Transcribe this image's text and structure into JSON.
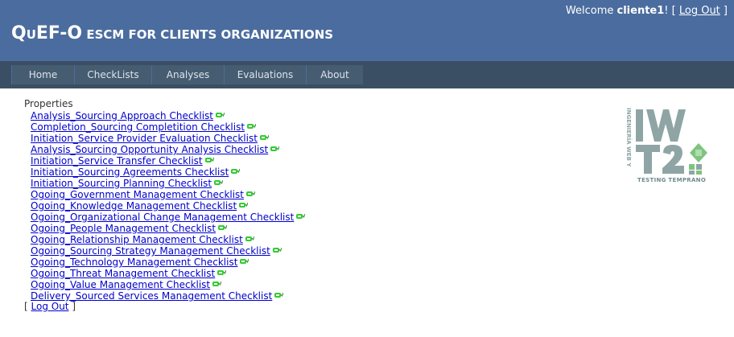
{
  "header": {
    "title_big_1": "Q",
    "title_small_1": "U",
    "title_big_2": "EF-O",
    "title_small_2": " ESCM FOR CLIENTS ORGANIZATIONS",
    "welcome_prefix": "Welcome ",
    "username": "cliente1",
    "welcome_suffix": "! [ ",
    "logout_label": "Log Out",
    "bracket_close": " ]"
  },
  "nav": {
    "items": [
      "Home",
      "CheckLists",
      "Analyses",
      "Evaluations",
      "About"
    ]
  },
  "content": {
    "section_title": "Properties",
    "checklists": [
      "Analysis_Sourcing Approach Checklist",
      "Completion_Sourcing Completition Checklist",
      "Initiation_Service Provider Evaluation Checklist",
      "Analysis_Sourcing Opportunity Analysis Checklist",
      "Initiation_Service Transfer Checklist",
      "Initiation_Sourcing Agreements Checklist",
      "Initiation_Sourcing Planning Checklist",
      "Ogoing_Government Management Checklist",
      "Ogoing_Knowledge Management Checklist",
      "Ogoing_Organizational Change Management Checklist",
      "Ogoing_People Management Checklist",
      "Ogoing_Relationship Management Checklist",
      "Ogoing_Sourcing Strategy Management Checklist",
      "Ogoing_Technology Management Checklist",
      "Ogoing_Threat Management Checklist",
      "Ogoing_Value Management Checklist",
      "Delivery_Sourced Services Management Checklist"
    ],
    "row_icon": "eye-view-icon",
    "bottom_open": "[ ",
    "bottom_logout": "Log Out",
    "bottom_close": " ]"
  },
  "logo": {
    "vertical_text": "INGENIERÍA WEB Y",
    "caption": "TESTING TEMPRANO",
    "letters": "IWT2"
  },
  "colors": {
    "header_bg": "#4b6c9e",
    "nav_bg": "#3a4f63",
    "tab_bg": "#465c71",
    "link": "#0000cc",
    "icon_green": "#33cc33",
    "logo_gray": "#8fa5a5",
    "logo_green": "#7dc47d"
  }
}
